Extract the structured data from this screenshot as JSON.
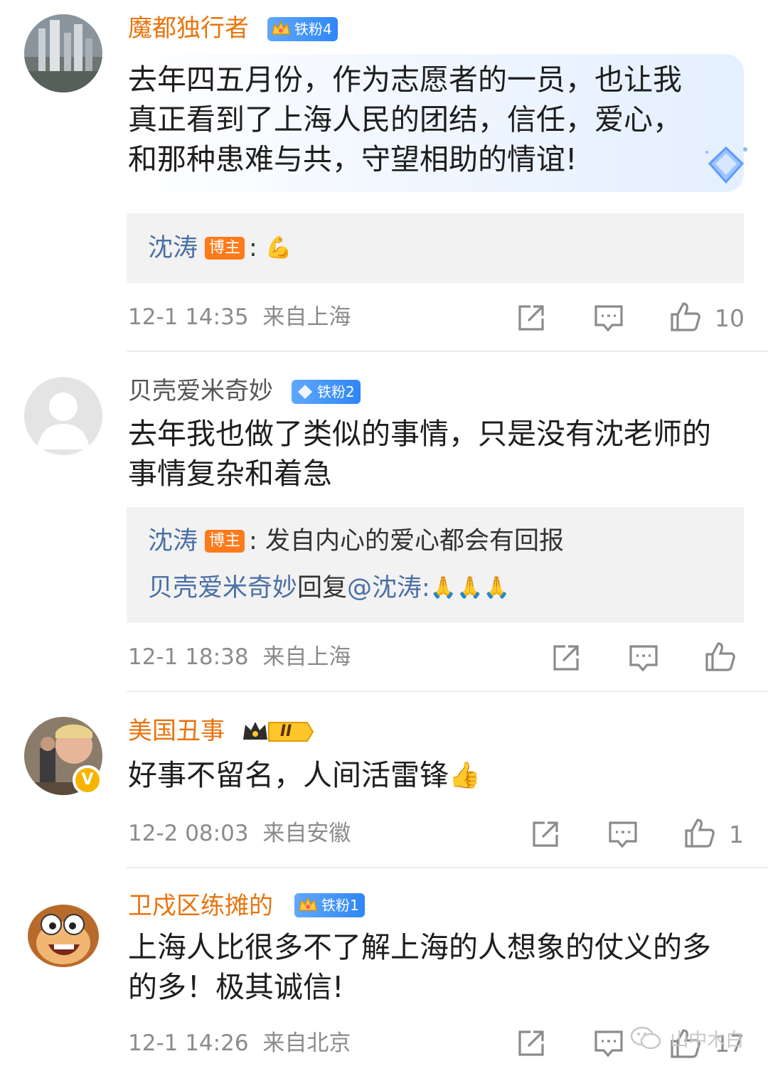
{
  "comments": [
    {
      "username": "魔都独行者",
      "fan_badge": "铁粉4",
      "content_lines": [
        "去年四五月份，作为志愿者的一员，也让我",
        "真正看到了上海人民的团结，信任，爱心，",
        "和那种患难与共，守望相助的情谊!"
      ],
      "reply": {
        "name": "沈涛",
        "tag": "博主",
        "text": ":"
      },
      "time": "12-1 14:35",
      "location": "来自上海",
      "likes": "10"
    },
    {
      "username": "贝壳爱米奇妙",
      "fan_badge": "铁粉2",
      "content_lines": [
        "去年我也做了类似的事情，只是没有沈老师的",
        "事情复杂和着急"
      ],
      "reply": {
        "name": "沈涛",
        "tag": "博主",
        "text": ": 发自内心的爱心都会有回报"
      },
      "reply2": {
        "name": "贝壳爱米奇妙",
        "text": "回复",
        "mention": "@沈涛",
        "tail": ":"
      },
      "time": "12-1 18:38",
      "location": "来自上海",
      "likes": ""
    },
    {
      "username": "美国丑事",
      "fan_badge": "II",
      "verified": "V",
      "content_lines": [
        "好事不留名，人间活雷锋"
      ],
      "time": "12-2 08:03",
      "location": "来自安徽",
      "likes": "1"
    },
    {
      "username": "卫戍区练摊的",
      "fan_badge": "铁粉1",
      "content_lines": [
        "上海人比很多不了解上海的人想象的仗义的多",
        "的多！极其诚信!"
      ],
      "time": "12-1 14:26",
      "location": "来自北京",
      "likes": "17"
    }
  ],
  "icons": {
    "share": "share-icon",
    "comment": "comment-icon",
    "like": "thumbs-up-icon"
  },
  "watermark": {
    "text": "山中木白"
  },
  "colors": {
    "vip_name": "#e8740e",
    "reply_name": "#4a6fa5",
    "blogger_tag": "#ff7a1a",
    "meta_gray": "#8b8b8b"
  }
}
